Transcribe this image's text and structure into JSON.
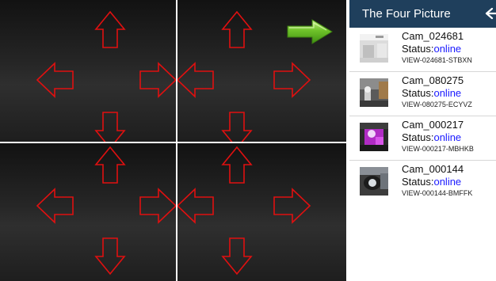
{
  "panel": {
    "title": "The Four Picture",
    "back_icon": "back-arrow-icon"
  },
  "grid": {
    "next_icon": "green-right-arrow-icon",
    "arrow_color": "#e01010"
  },
  "status_label": "Status:",
  "cameras": [
    {
      "name": "Cam_024681",
      "status": "online",
      "view": "VIEW-024681-STBXN"
    },
    {
      "name": "Cam_080275",
      "status": "online",
      "view": "VIEW-080275-ECYVZ"
    },
    {
      "name": "Cam_000217",
      "status": "online",
      "view": "VIEW-000217-MBHKB"
    },
    {
      "name": "Cam_000144",
      "status": "online",
      "view": "VIEW-000144-BMFFK"
    }
  ]
}
